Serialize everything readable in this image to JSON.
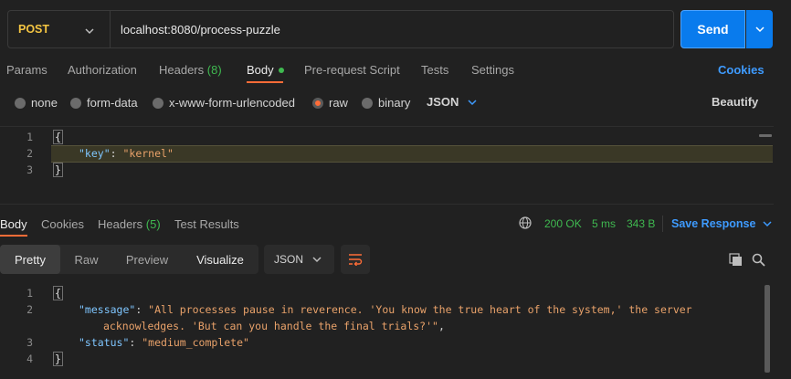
{
  "request": {
    "method": "POST",
    "url": "localhost:8080/process-puzzle",
    "send_label": "Send"
  },
  "request_tabs": [
    {
      "label": "Params"
    },
    {
      "label": "Authorization"
    },
    {
      "label": "Headers",
      "count": "(8)"
    },
    {
      "label": "Body"
    },
    {
      "label": "Pre-request Script"
    },
    {
      "label": "Tests"
    },
    {
      "label": "Settings"
    }
  ],
  "cookies_label": "Cookies",
  "body_types": [
    {
      "label": "none"
    },
    {
      "label": "form-data"
    },
    {
      "label": "x-www-form-urlencoded"
    },
    {
      "label": "raw"
    },
    {
      "label": "binary"
    }
  ],
  "body_format": "JSON",
  "beautify_label": "Beautify",
  "request_body": {
    "line_numbers": [
      "1",
      "2",
      "3"
    ],
    "open_brace": "{",
    "key": "\"key\"",
    "colon": ": ",
    "value": "\"kernel\"",
    "close_brace": "}"
  },
  "response_tabs": [
    {
      "label": "Body"
    },
    {
      "label": "Cookies"
    },
    {
      "label": "Headers",
      "count": "(5)"
    },
    {
      "label": "Test Results"
    }
  ],
  "response_status": {
    "status": "200 OK",
    "time": "5 ms",
    "size": "343 B",
    "save_label": "Save Response"
  },
  "response_views": [
    {
      "label": "Pretty"
    },
    {
      "label": "Raw"
    },
    {
      "label": "Preview"
    },
    {
      "label": "Visualize"
    }
  ],
  "response_format": "JSON",
  "response_body": {
    "line_numbers": [
      "1",
      "2",
      "3",
      "4"
    ],
    "open_brace": "{",
    "message_key": "\"message\"",
    "colon": ": ",
    "message_value_part1": "\"All processes pause in reverence. 'You know the true heart of the system,' the server",
    "message_value_part2": "acknowledges. 'But can you handle the final trials?'\"",
    "comma": ",",
    "status_key": "\"status\"",
    "status_value": "\"medium_complete\"",
    "close_brace": "}"
  },
  "colors": {
    "accent_orange": "#ff6c37",
    "send_blue": "#097bed",
    "link_blue": "#3e9bff",
    "status_green": "#3fb950",
    "method_yellow": "#f4c542"
  }
}
